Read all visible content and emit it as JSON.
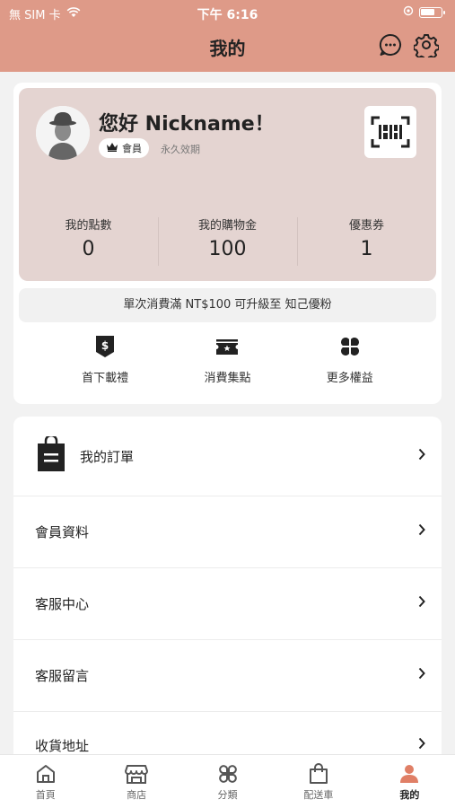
{
  "status_bar": {
    "carrier": "無 SIM 卡",
    "time": "下午 6:16"
  },
  "header": {
    "title": "我的",
    "icons": [
      "chat-bubble-icon",
      "gear-icon"
    ]
  },
  "member": {
    "greeting": "您好 Nickname！",
    "badge": "會員",
    "validity": "永久效期",
    "stats": [
      {
        "label": "我的點數",
        "value": "0"
      },
      {
        "label": "我的購物金",
        "value": "100"
      },
      {
        "label": "優惠券",
        "value": "1"
      }
    ],
    "upgrade_text": "單次消費滿 NT$100 可升級至 知己優粉",
    "perks": [
      {
        "label": "首下載禮",
        "icon": "dollar-tag-icon"
      },
      {
        "label": "消費集點",
        "icon": "ticket-icon"
      },
      {
        "label": "更多權益",
        "icon": "clover-icon"
      }
    ]
  },
  "menu": {
    "orders_label": "我的訂單",
    "items": [
      {
        "label": "會員資料"
      },
      {
        "label": "客服中心"
      },
      {
        "label": "客服留言"
      },
      {
        "label": "收貨地址"
      }
    ]
  },
  "bottom_nav": [
    {
      "label": "首頁",
      "icon": "home-icon"
    },
    {
      "label": "商店",
      "icon": "store-icon"
    },
    {
      "label": "分類",
      "icon": "category-icon"
    },
    {
      "label": "配送車",
      "icon": "bag-icon"
    },
    {
      "label": "我的",
      "icon": "person-icon",
      "active": true
    }
  ],
  "colors": {
    "header": "#de9a88",
    "card": "#e4d4d1",
    "accent": "#e07f66"
  }
}
